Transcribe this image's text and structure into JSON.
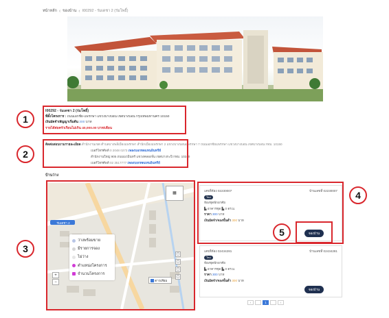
{
  "breadcrumb": {
    "home": "หน้าหลัก",
    "section": "ของบ้าน",
    "current": "I00292 - ร่มเดชา 2 (ร่มโพธิ์)"
  },
  "project": {
    "title": "I00292 - ร่มเดชา 2 (ร่มโพธิ์)",
    "address_label": "ที่ตั้งโครงการ :",
    "address_value": "ถนนเอกชัย-แพรกษา แขวงบางบอน เขตบางบอน กรุงเทพมหานคร 10150",
    "deposit_label": "เงินมัดจำ/สัญญาเริ่มต้น",
    "deposit_value": "300",
    "deposit_unit": "บาท",
    "income_note": "รายได้ต่อครัวเรือนไม่เกิน 40,000.00 บาท/เดือน"
  },
  "contacts": {
    "header": "ติดต่อสอบถามรายละเอียด",
    "line1": "สำนักงานเขต ตำบลบางพลีเมืองแพรกษา สำนักเมืองแพรกษา 2 แขวงบางบอนแพรกษา 7 ถนนเอกชัยแพรกษา แขวงบางบอน เขตบางบอน กทม. 10150",
    "tel1_label": "เบอร์โทรศัพท์",
    "tel1_value": "0 2048 0273",
    "tel1_link": "เพลงบอกทดแทนอินทรีย์",
    "line2": "สำนักงานใหญ่ 905 ถนนนวมินทร์ แขวงคลองจั่น เขตบางกะปิ กทม. 10240",
    "tel2_label": "เบอร์โทรศัพท์",
    "tel2_value": "02 3517777",
    "tel2_link": "เพลงบอกทดแทนอินทรีย์"
  },
  "units_label": "บ้านว่าง",
  "map": {
    "legend": [
      {
        "label": "ว่างพร้อมขาย",
        "color": "#b9c6e6"
      },
      {
        "label": "มีรายการจอง",
        "color": "#d6d6d6"
      },
      {
        "label": "ไม่ว่าง",
        "color": "#e6e6e6"
      },
      {
        "label": "ตำแหน่งโครงการ",
        "color": "#d13bd6"
      },
      {
        "label": "จำนวนโครงการ",
        "color": "#d13bd6"
      }
    ],
    "zoom_in": "+",
    "zoom_out": "−",
    "map_label": "ร่มเดชา 2",
    "layer_label": "ดาวเทียม"
  },
  "cards": [
    {
      "id_label": "เลขที่ห้อง",
      "id_value": "02230007",
      "no_label": "บ้านเลขที่",
      "no_value": "02230007",
      "badge": "ใหม่",
      "type": "ห้องชุดพักอาศัย",
      "area_label": "อาคารชุด",
      "area_value": "0 ตร.ม.",
      "price_label": "ราคา",
      "price_value": "300",
      "price_unit": "บาท",
      "deposit_label": "เงินมัดจำ/จองขั้นต่ำ",
      "deposit_value": "300",
      "deposit_unit": "บาท",
      "button": "จองบ้าน"
    },
    {
      "id_label": "เลขที่ห้อง",
      "id_value": "02434281",
      "no_label": "บ้านเลขที่",
      "no_value": "02434281",
      "badge": "ใหม่",
      "type": "ห้องชุดพักอาศัย",
      "area_label": "อาคารชุด",
      "area_value": "0 ตร.ม.",
      "price_label": "ราคา",
      "price_value": "300",
      "price_unit": "บาท",
      "deposit_label": "เงินมัดจำ/จองขั้นต่ำ",
      "deposit_value": "300",
      "deposit_unit": "บาท",
      "button": "จองบ้าน"
    }
  ],
  "pager": {
    "prev": "‹",
    "page": "1",
    "next": "›"
  },
  "callouts": {
    "n1": "1",
    "n2": "2",
    "n3": "3",
    "n4": "4",
    "n5": "5"
  },
  "colors": {
    "annotation": "#d9262c",
    "button": "#1f3050",
    "link": "#2e6bd6"
  }
}
